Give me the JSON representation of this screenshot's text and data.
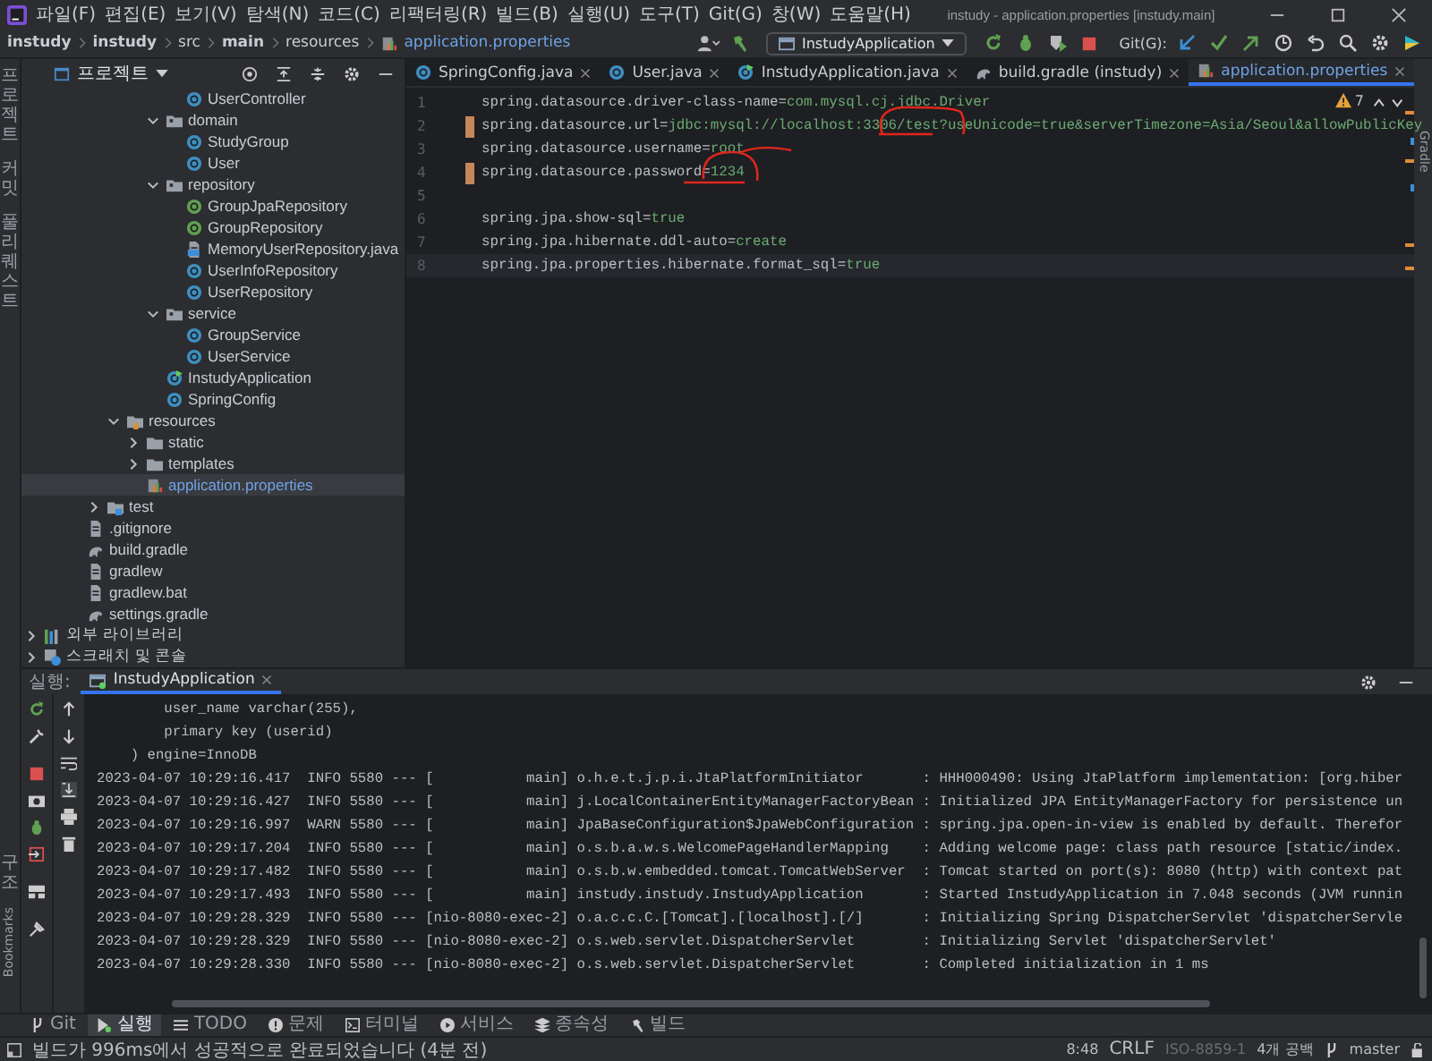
{
  "title_bar": {
    "menus": [
      "파일(F)",
      "편집(E)",
      "보기(V)",
      "탐색(N)",
      "코드(C)",
      "리팩터링(R)",
      "빌드(B)",
      "실행(U)",
      "도구(T)",
      "Git(G)",
      "창(W)",
      "도움말(H)"
    ],
    "title": "instudy - application.properties [instudy.main]"
  },
  "breadcrumbs": [
    {
      "label": "instudy",
      "bold": true,
      "kind": "folder"
    },
    {
      "label": "instudy",
      "bold": true,
      "kind": "folder"
    },
    {
      "label": "src",
      "bold": false,
      "kind": "folder"
    },
    {
      "label": "main",
      "bold": true,
      "kind": "folder"
    },
    {
      "label": "resources",
      "bold": false,
      "kind": "folder"
    },
    {
      "label": "application.properties",
      "bold": false,
      "kind": "file"
    }
  ],
  "toolbar": {
    "run_config": "InstudyApplication",
    "git_label": "Git(G):"
  },
  "left_strip": {
    "top": [
      "프로젝트",
      "커밋",
      "풀 리퀘스트"
    ],
    "bottom": [
      "구조",
      "Bookmarks"
    ]
  },
  "right_strip": [
    "Gradle"
  ],
  "project_panel": {
    "title": "프로젝트",
    "tree": [
      {
        "children": [
          {
            "children": [
              {
                "children": [
                  {
                    "children": [
                      {
                        "children": [
                          {
                            "children": [
                              {
                                "label": "UserController",
                                "kind": "class",
                                "selected": false
                              }
                            ]
                          },
                          {
                            "label": "domain",
                            "kind": "package",
                            "expanded": true,
                            "selected": false,
                            "children": [
                              {
                                "label": "StudyGroup",
                                "kind": "class",
                                "selected": false
                              },
                              {
                                "label": "User",
                                "kind": "class",
                                "selected": false
                              }
                            ]
                          },
                          {
                            "label": "repository",
                            "kind": "package",
                            "expanded": true,
                            "selected": false,
                            "children": [
                              {
                                "label": "GroupJpaRepository",
                                "kind": "interface",
                                "selected": false
                              },
                              {
                                "label": "GroupRepository",
                                "kind": "interface",
                                "selected": false
                              },
                              {
                                "label": "MemoryUserRepository.java",
                                "kind": "java-file",
                                "selected": false
                              },
                              {
                                "label": "UserInfoRepository",
                                "kind": "class",
                                "selected": false
                              },
                              {
                                "label": "UserRepository",
                                "kind": "class",
                                "selected": false
                              }
                            ]
                          },
                          {
                            "label": "service",
                            "kind": "package",
                            "expanded": true,
                            "selected": false,
                            "children": [
                              {
                                "label": "GroupService",
                                "kind": "class",
                                "selected": false
                              },
                              {
                                "label": "UserService",
                                "kind": "class",
                                "selected": false
                              }
                            ]
                          },
                          {
                            "label": "InstudyApplication",
                            "kind": "app-class",
                            "selected": false
                          },
                          {
                            "label": "SpringConfig",
                            "kind": "class",
                            "selected": false
                          }
                        ]
                      }
                    ]
                  },
                  {
                    "label": "resources",
                    "kind": "resources-folder",
                    "expanded": true,
                    "selected": false,
                    "children": [
                      {
                        "label": "static",
                        "kind": "folder",
                        "expanded": false,
                        "selected": false
                      },
                      {
                        "label": "templates",
                        "kind": "folder",
                        "expanded": false,
                        "selected": false
                      },
                      {
                        "label": "application.properties",
                        "kind": "properties",
                        "selected": true
                      }
                    ]
                  }
                ]
              },
              {
                "label": "test",
                "kind": "test-folder",
                "expanded": false,
                "selected": false
              }
            ]
          },
          {
            "label": ".gitignore",
            "kind": "gitignore",
            "selected": false
          },
          {
            "label": "build.gradle",
            "kind": "gradle",
            "selected": false
          },
          {
            "label": "gradlew",
            "kind": "script",
            "selected": false
          },
          {
            "label": "gradlew.bat",
            "kind": "bat",
            "selected": false
          },
          {
            "label": "settings.gradle",
            "kind": "gradle",
            "selected": false
          }
        ]
      },
      {
        "label": "외부 라이브러리",
        "kind": "library",
        "expanded": false,
        "selected": false
      },
      {
        "label": "스크래치 및 콘솔",
        "kind": "scratch",
        "expanded": false,
        "selected": false
      }
    ]
  },
  "editor": {
    "tabs": [
      {
        "label": "SpringConfig.java",
        "kind": "class",
        "selected": false
      },
      {
        "label": "User.java",
        "kind": "class",
        "selected": false
      },
      {
        "label": "InstudyApplication.java",
        "kind": "app-class",
        "selected": false
      },
      {
        "label": "build.gradle (instudy)",
        "kind": "gradle",
        "selected": false
      },
      {
        "label": "application.properties",
        "kind": "properties",
        "selected": true
      }
    ],
    "warnings": "7",
    "lines": [
      {
        "number": "1",
        "key": "spring.datasource.driver-class-name=",
        "value": "com.mysql.cj.jdbc.Driver",
        "modified": false,
        "current": false
      },
      {
        "number": "2",
        "key": "spring.datasource.url=",
        "value": "jdbc:mysql://localhost:3306/test?useUnicode=true&serverTimezone=Asia/Seoul&allowPublicKey",
        "modified": true,
        "current": false
      },
      {
        "number": "3",
        "key": "spring.datasource.username=",
        "value": "root",
        "modified": false,
        "current": false
      },
      {
        "number": "4",
        "key": "spring.datasource.password=",
        "value": "1234",
        "modified": true,
        "current": false
      },
      {
        "number": "5",
        "modified": false,
        "current": false
      },
      {
        "number": "6",
        "key": "spring.jpa.show-sql=",
        "value": "true",
        "modified": false,
        "current": false
      },
      {
        "number": "7",
        "key": "spring.jpa.hibernate.ddl-auto=",
        "value": "create",
        "modified": false,
        "current": false
      },
      {
        "number": "8",
        "key": "spring.jpa.properties.hibernate.format_sql=",
        "value": "true",
        "modified": false,
        "current": true
      }
    ]
  },
  "run_panel": {
    "label": "실행:",
    "tab": "InstudyApplication",
    "console": [
      "        user_name varchar(255),",
      "        primary key (userid)",
      "    ) engine=InnoDB",
      "2023-04-07 10:29:16.417  INFO 5580 --- [           main] o.h.e.t.j.p.i.JtaPlatformInitiator       : HHH000490: Using JtaPlatform implementation: [org.hiber",
      "2023-04-07 10:29:16.427  INFO 5580 --- [           main] j.LocalContainerEntityManagerFactoryBean : Initialized JPA EntityManagerFactory for persistence un",
      "2023-04-07 10:29:16.997  WARN 5580 --- [           main] JpaBaseConfiguration$JpaWebConfiguration : spring.jpa.open-in-view is enabled by default. Therefor",
      "2023-04-07 10:29:17.204  INFO 5580 --- [           main] o.s.b.a.w.s.WelcomePageHandlerMapping    : Adding welcome page: class path resource [static/index.",
      "2023-04-07 10:29:17.482  INFO 5580 --- [           main] o.s.b.w.embedded.tomcat.TomcatWebServer  : Tomcat started on port(s): 8080 (http) with context pat",
      "2023-04-07 10:29:17.493  INFO 5580 --- [           main] instudy.instudy.InstudyApplication       : Started InstudyApplication in 7.048 seconds (JVM runnin",
      "2023-04-07 10:29:28.329  INFO 5580 --- [nio-8080-exec-2] o.a.c.c.C.[Tomcat].[localhost].[/]       : Initializing Spring DispatcherServlet 'dispatcherServle",
      "2023-04-07 10:29:28.329  INFO 5580 --- [nio-8080-exec-2] o.s.web.servlet.DispatcherServlet        : Initializing Servlet 'dispatcherServlet'",
      "2023-04-07 10:29:28.330  INFO 5580 --- [nio-8080-exec-2] o.s.web.servlet.DispatcherServlet        : Completed initialization in 1 ms"
    ]
  },
  "tool_tabs": [
    {
      "label": "Git",
      "kind": "git",
      "selected": false
    },
    {
      "label": "실행",
      "kind": "run",
      "selected": true
    },
    {
      "label": "TODO",
      "kind": "list",
      "selected": false
    },
    {
      "label": "문제",
      "kind": "problems",
      "selected": false
    },
    {
      "label": "터미널",
      "kind": "terminal",
      "selected": false
    },
    {
      "label": "서비스",
      "kind": "services",
      "selected": false
    },
    {
      "label": "종속성",
      "kind": "deps",
      "selected": false
    },
    {
      "label": "빌드",
      "kind": "build",
      "selected": false
    }
  ],
  "status_bar": {
    "message": "빌드가 996ms에서 성공적으로 완료되었습니다 (4분 전)",
    "position": "8:48",
    "line_separator": "CRLF",
    "encoding": "ISO-8859-1",
    "indent": "4개 공백",
    "branch": "master"
  }
}
